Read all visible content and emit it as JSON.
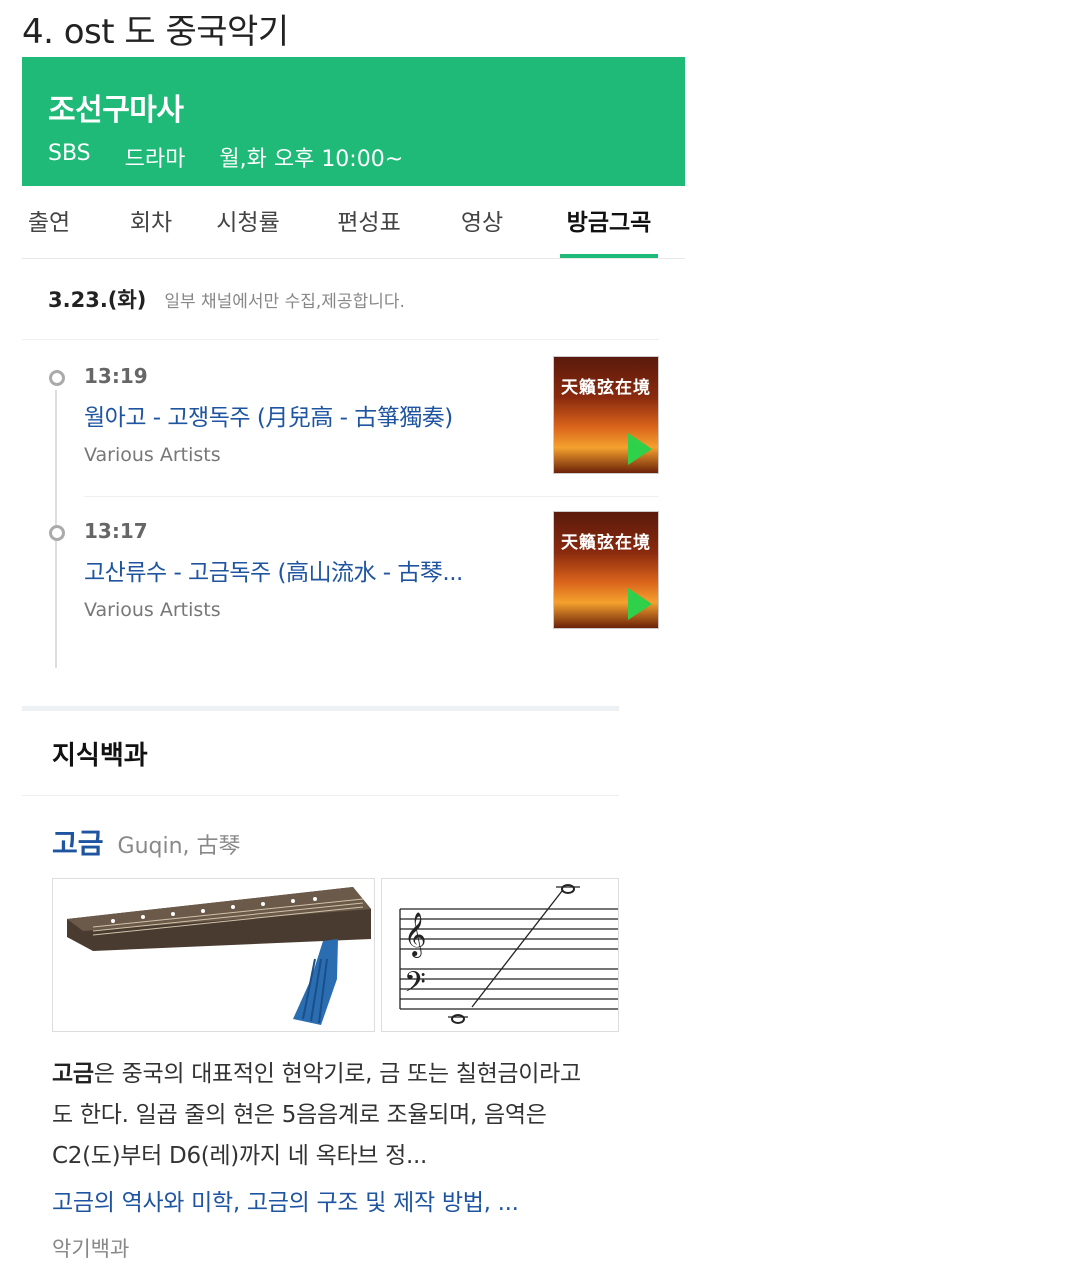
{
  "caption": "4. ost 도 중국악기",
  "program": {
    "title": "조선구마사",
    "channel": "SBS",
    "genre": "드라마",
    "schedule": "월,화 오후 10:00~"
  },
  "tabs": [
    {
      "label": "출연"
    },
    {
      "label": "회차"
    },
    {
      "label": "시청률"
    },
    {
      "label": "편성표"
    },
    {
      "label": "영상"
    },
    {
      "label": "방금그곡"
    }
  ],
  "playlist": {
    "date": "3.23.(화)",
    "note": "일부 채널에서만 수집,제공합니다.",
    "tracks": [
      {
        "time": "13:19",
        "title": "월아고 - 고쟁독주 (月兒高 - 古箏獨奏)",
        "artist": "Various Artists",
        "album_caption": "天籟弦在境"
      },
      {
        "time": "13:17",
        "title": "고산류수 - 고금독주 (高山流水 - 古琴...",
        "artist": "Various Artists",
        "album_caption": "天籟弦在境"
      }
    ]
  },
  "encyclopedia": {
    "section_title": "지식백과",
    "entry_name": "고금",
    "entry_alt": "Guqin, 古琴",
    "desc_bold": "고금",
    "desc_text": "은 중국의 대표적인 현악기로, 금 또는 칠현금이라고도 한다. 일곱 줄의 현은 5음음계로 조율되며, 음역은 C2(도)부터 D6(레)까지 네 옥타브 정...",
    "links": "고금의 역사와 미학, 고금의 구조 및 제작 방법, ...",
    "source": "악기백과"
  },
  "colors": {
    "brand_green": "#1fba78",
    "link_blue": "#1f55a0"
  }
}
